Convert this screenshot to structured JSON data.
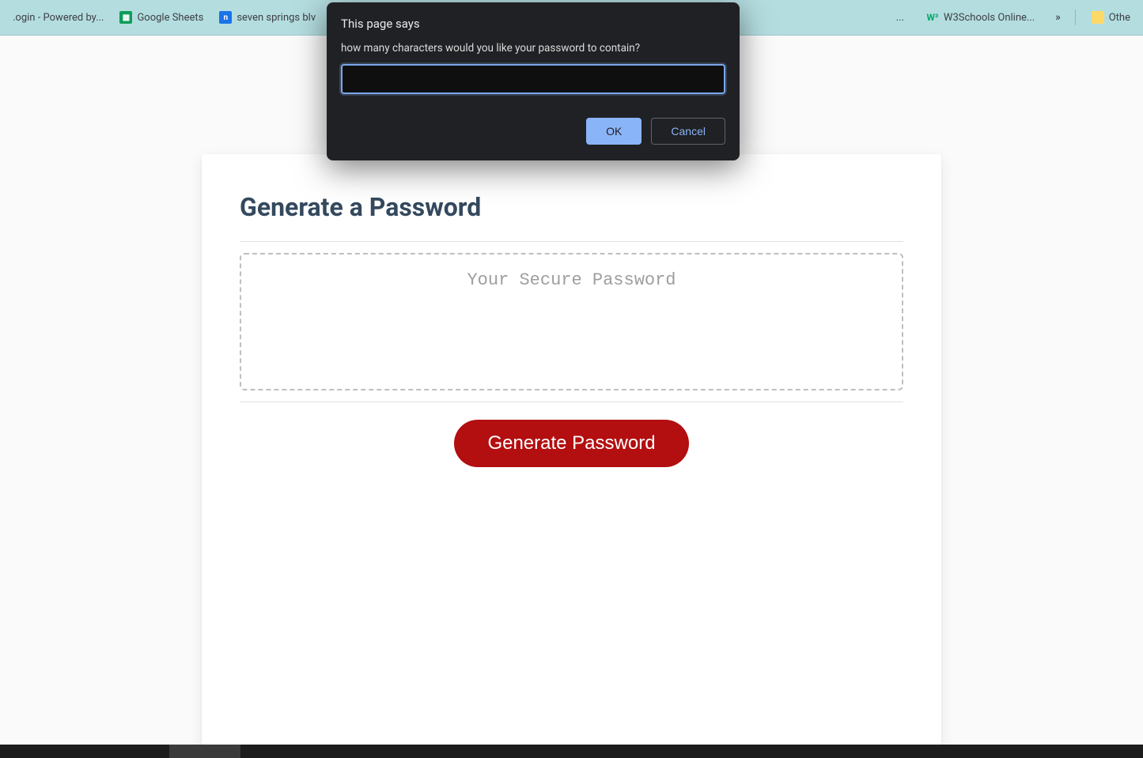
{
  "bookmarks": {
    "items": [
      {
        "label": ".ogin - Powered by...",
        "icon": "generic"
      },
      {
        "label": "Google Sheets",
        "icon": "sheets"
      },
      {
        "label": "seven springs blv",
        "icon": "nest"
      }
    ],
    "right_items": [
      {
        "label": "...",
        "icon": ""
      },
      {
        "label": "W3Schools Online...",
        "icon": "w3"
      }
    ],
    "overflow": "»",
    "other_label": "Othe"
  },
  "dialog": {
    "title": "This page says",
    "message": "how many characters would you like your password to contain?",
    "input_value": "",
    "ok_label": "OK",
    "cancel_label": "Cancel"
  },
  "card": {
    "title": "Generate a Password",
    "placeholder": "Your Secure Password",
    "button_label": "Generate Password"
  }
}
